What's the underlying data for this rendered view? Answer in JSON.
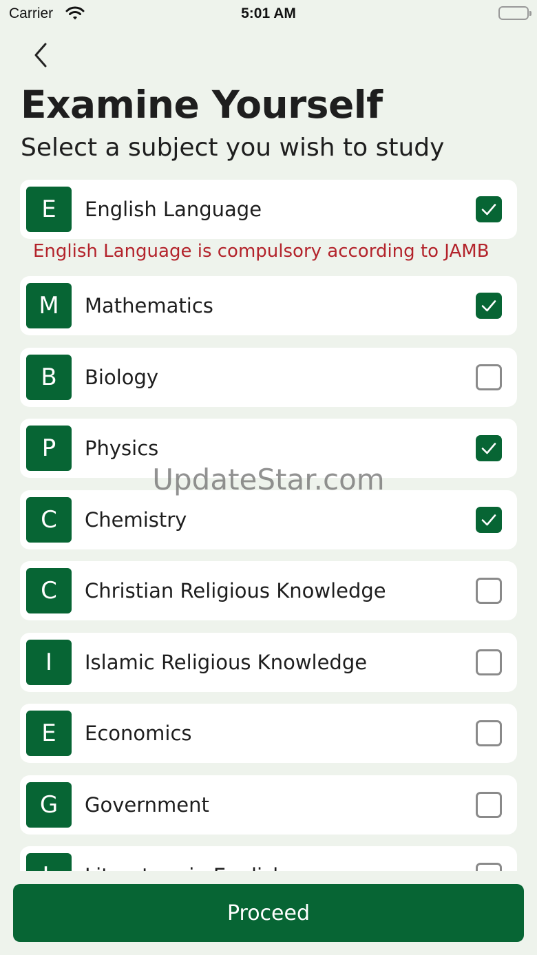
{
  "status_bar": {
    "carrier": "Carrier",
    "time": "5:01 AM"
  },
  "header": {
    "title": "Examine Yourself",
    "subtitle": "Select a subject you wish to study"
  },
  "compulsory_note": "English Language is compulsory according to JAMB",
  "subjects": [
    {
      "initial": "E",
      "name": "English Language",
      "checked": true
    },
    {
      "initial": "M",
      "name": "Mathematics",
      "checked": true
    },
    {
      "initial": "B",
      "name": "Biology",
      "checked": false
    },
    {
      "initial": "P",
      "name": "Physics",
      "checked": true
    },
    {
      "initial": "C",
      "name": "Chemistry",
      "checked": true
    },
    {
      "initial": "C",
      "name": "Christian Religious Knowledge",
      "checked": false
    },
    {
      "initial": "I",
      "name": "Islamic Religious Knowledge",
      "checked": false
    },
    {
      "initial": "E",
      "name": "Economics",
      "checked": false
    },
    {
      "initial": "G",
      "name": "Government",
      "checked": false
    },
    {
      "initial": "L",
      "name": "Literature in English",
      "checked": false
    }
  ],
  "watermark": "UpdateStar.com",
  "proceed_label": "Proceed",
  "colors": {
    "primary": "#076534",
    "error": "#b3232b",
    "background": "#eef3ec"
  }
}
